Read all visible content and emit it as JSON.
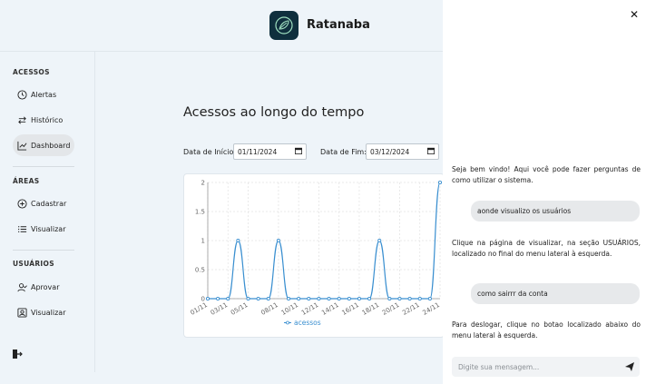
{
  "header": {
    "app_title": "Ratanaba"
  },
  "sidebar": {
    "sections": [
      {
        "label": "ACESSOS",
        "items": [
          {
            "label": "Alertas",
            "icon": "clock-icon"
          },
          {
            "label": "Histórico",
            "icon": "swap-arrows-icon"
          },
          {
            "label": "Dashboard",
            "icon": "trend-chart-icon",
            "active": true
          }
        ]
      },
      {
        "label": "ÁREAS",
        "items": [
          {
            "label": "Cadastrar",
            "icon": "plus-circle-icon"
          },
          {
            "label": "Visualizar",
            "icon": "list-icon"
          }
        ]
      },
      {
        "label": "USUÁRIOS",
        "items": [
          {
            "label": "Aprovar",
            "icon": "user-check-icon"
          },
          {
            "label": "Visualizar",
            "icon": "user-card-icon"
          }
        ]
      }
    ]
  },
  "main": {
    "title": "Acessos ao longo do tempo",
    "start_label": "Data de Início:",
    "start_value": "01/11/2024",
    "end_label": "Data de Fim:",
    "end_value": "03/12/2024"
  },
  "chart_data": {
    "type": "line",
    "x": [
      "01/11",
      "02/11",
      "03/11",
      "04/11",
      "05/11",
      "06/11",
      "07/11",
      "08/11",
      "09/11",
      "10/11",
      "11/11",
      "12/11",
      "13/11",
      "14/11",
      "15/11",
      "16/11",
      "17/11",
      "18/11",
      "19/11",
      "20/11",
      "21/11",
      "22/11",
      "23/11",
      "24/11"
    ],
    "tick_labels": [
      "01/11",
      "03/11",
      "05/11",
      "08/11",
      "10/11",
      "12/11",
      "14/11",
      "16/11",
      "18/11",
      "20/11",
      "22/11",
      "24/11"
    ],
    "series": [
      {
        "name": "acessos",
        "values": [
          0,
          0,
          0,
          1,
          0,
          0,
          0,
          1,
          0,
          0,
          0,
          0,
          0,
          0,
          0,
          0,
          0,
          1,
          0,
          0,
          0,
          0,
          0,
          2
        ]
      }
    ],
    "ylim": [
      0,
      2
    ],
    "yticks": [
      "0",
      "0.5",
      "1",
      "1.5",
      "2"
    ],
    "grid": true,
    "legend": "bottom",
    "color": "#3a8fd0"
  },
  "chat": {
    "messages": [
      {
        "from": "bot",
        "text": "Seja bem vindo! Aqui você pode fazer perguntas de como utilizar o sistema."
      },
      {
        "from": "user",
        "text": "aonde visualizo os usuários"
      },
      {
        "from": "bot",
        "text": "Clique na página de visualizar, na seção USUÁRIOS, localizado no final do menu lateral à esquerda."
      },
      {
        "from": "user",
        "text": "como sairrr da conta"
      },
      {
        "from": "bot",
        "text": "Para deslogar, clique no botao localizado abaixo do menu lateral à esquerda."
      }
    ],
    "input_placeholder": "Digite sua mensagem..."
  }
}
